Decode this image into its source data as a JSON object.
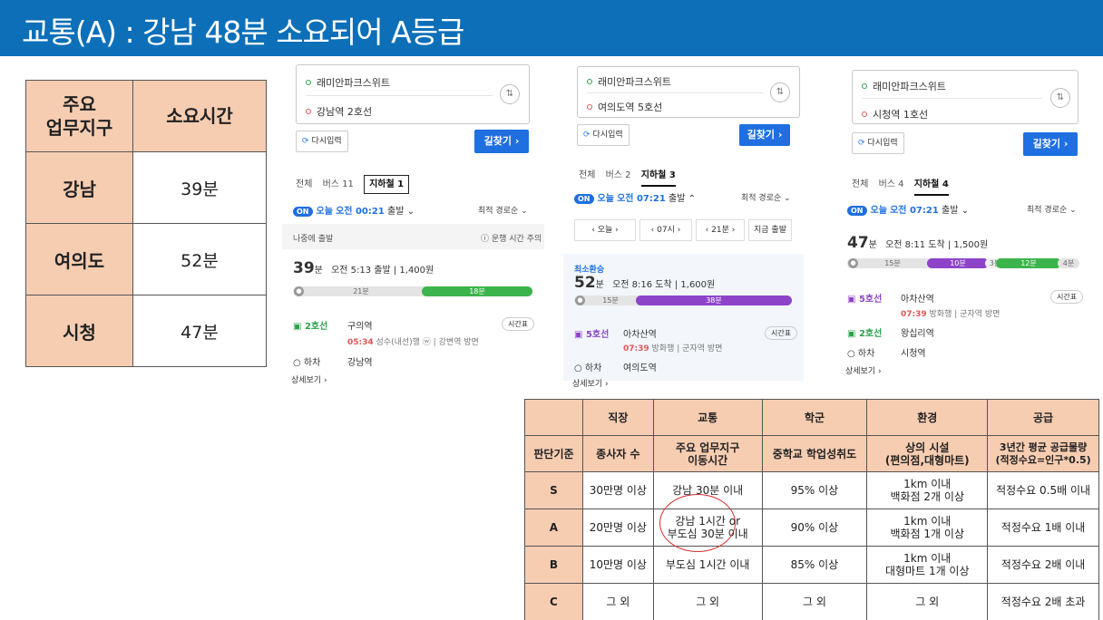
{
  "title": "교통(A) : 강남 48분 소요되어 A등급",
  "summary": {
    "header_district": "주요\n업무지구",
    "header_time": "소요시간",
    "rows": [
      {
        "district": "강남",
        "time": "39분"
      },
      {
        "district": "여의도",
        "time": "52분"
      },
      {
        "district": "시청",
        "time": "47분"
      }
    ]
  },
  "routes": [
    {
      "origin": "래미안파크스위트",
      "destination": "강남역 2호선",
      "reset_label": "다시입력",
      "find_label": "길찾기 ›",
      "tabs": [
        "전체",
        "버스 11",
        "지하철 1"
      ],
      "active_tab": 2,
      "depart_on": "ON",
      "depart_today": "오늘",
      "depart_time": "오전 00:21",
      "depart_suffix": "출발 ⌄",
      "sort": "최적 경로순 ⌄",
      "later_label": "나중에 출발",
      "note_label": "ⓘ 운행 시간 주의",
      "total_min": "39",
      "total_unit": "분",
      "summary_line": "오전 5:13 출발 | 1,400원",
      "walk_seg": "21분",
      "ride_seg": "18분",
      "line": "2호선",
      "board_station": "구의역",
      "board_time": "05:34",
      "board_detail": "성수(내선)행 ⓦ | 강변역 방면",
      "timetable": "시간표",
      "alight_label": "○ 하차",
      "alight_station": "강남역",
      "more_label": "상세보기 ›"
    },
    {
      "origin": "래미안파크스위트",
      "destination": "여의도역 5호선",
      "reset_label": "다시입력",
      "find_label": "길찾기 ›",
      "tabs": [
        "전체",
        "버스 2",
        "지하철 3"
      ],
      "active_tab": 2,
      "depart_on": "ON",
      "depart_today": "오늘",
      "depart_time": "오전 07:21",
      "depart_suffix": "출발 ⌃",
      "sort": "최적 경로순 ⌄",
      "stepper_day": "오늘",
      "stepper_hour": "07시",
      "stepper_min": "21분",
      "stepper_now": "지금 출발",
      "badge": "최소환승",
      "total_min": "52",
      "total_unit": "분",
      "summary_line": "오전 8:16 도착 | 1,600원",
      "walk_seg": "15분",
      "ride_seg": "38분",
      "line": "5호선",
      "board_station": "아차산역",
      "board_time": "07:39",
      "board_detail": "방화행 | 군자역 방면",
      "timetable": "시간표",
      "alight_label": "○ 하차",
      "alight_station": "여의도역",
      "more_label": "상세보기 ›"
    },
    {
      "origin": "래미안파크스위트",
      "destination": "시청역 1호선",
      "reset_label": "다시입력",
      "find_label": "길찾기 ›",
      "tabs": [
        "전체",
        "버스 4",
        "지하철 4"
      ],
      "active_tab": 2,
      "depart_on": "ON",
      "depart_today": "오늘",
      "depart_time": "오전 07:21",
      "depart_suffix": "출발 ⌄",
      "sort": "최적 경로순 ⌄",
      "total_min": "47",
      "total_unit": "분",
      "summary_line": "오전 8:11 도착 | 1,500원",
      "walk_seg": "15분",
      "ride_seg": "10분",
      "transfer_seg": "3분",
      "ride_seg2": "12분",
      "walk_seg2": "4분",
      "line": "5호선",
      "board_station": "아차산역",
      "board_time": "07:39",
      "board_detail": "방화행 | 군자역 방면",
      "timetable": "시간표",
      "line2": "2호선",
      "transfer_station": "왕십리역",
      "alight_label": "○ 하차",
      "alight_station": "시청역",
      "more_label": "상세보기 ›"
    }
  ],
  "criteria": {
    "header": [
      "",
      "직장",
      "교통",
      "학군",
      "환경",
      "공급"
    ],
    "header2": [
      "판단기준",
      "종사자 수",
      "주요 업무지구\n이동시간",
      "중학교 학업성취도",
      "상의 시설\n(편의점,대형마트)",
      "3년간 평균 공급물량\n(적정수요=인구*0.5)"
    ],
    "rows": [
      [
        "S",
        "30만명 이상",
        "강남 30분 이내",
        "95% 이상",
        "1km 이내\n백화점 2개 이상",
        "적정수요 0.5배 이내"
      ],
      [
        "A",
        "20만명 이상",
        "강남 1시간 or\n부도심 30분 이내",
        "90% 이상",
        "1km 이내\n백화점 1개 이상",
        "적정수요 1배 이내"
      ],
      [
        "B",
        "10만명 이상",
        "부도심 1시간 이내",
        "85% 이상",
        "1km 이내\n대형마트 1개 이상",
        "적정수요 2배 이내"
      ],
      [
        "C",
        "그 외",
        "그 외",
        "그 외",
        "그 외",
        "적정수요 2배 초과"
      ]
    ]
  },
  "colors": {
    "banner": "#0c6fb8",
    "header_fill": "#f7cdb2",
    "line2_green": "#3cb44b",
    "line5_purple": "#8e44c9",
    "accent_blue": "#1f6fe0",
    "circle_red": "#d62f2f"
  }
}
